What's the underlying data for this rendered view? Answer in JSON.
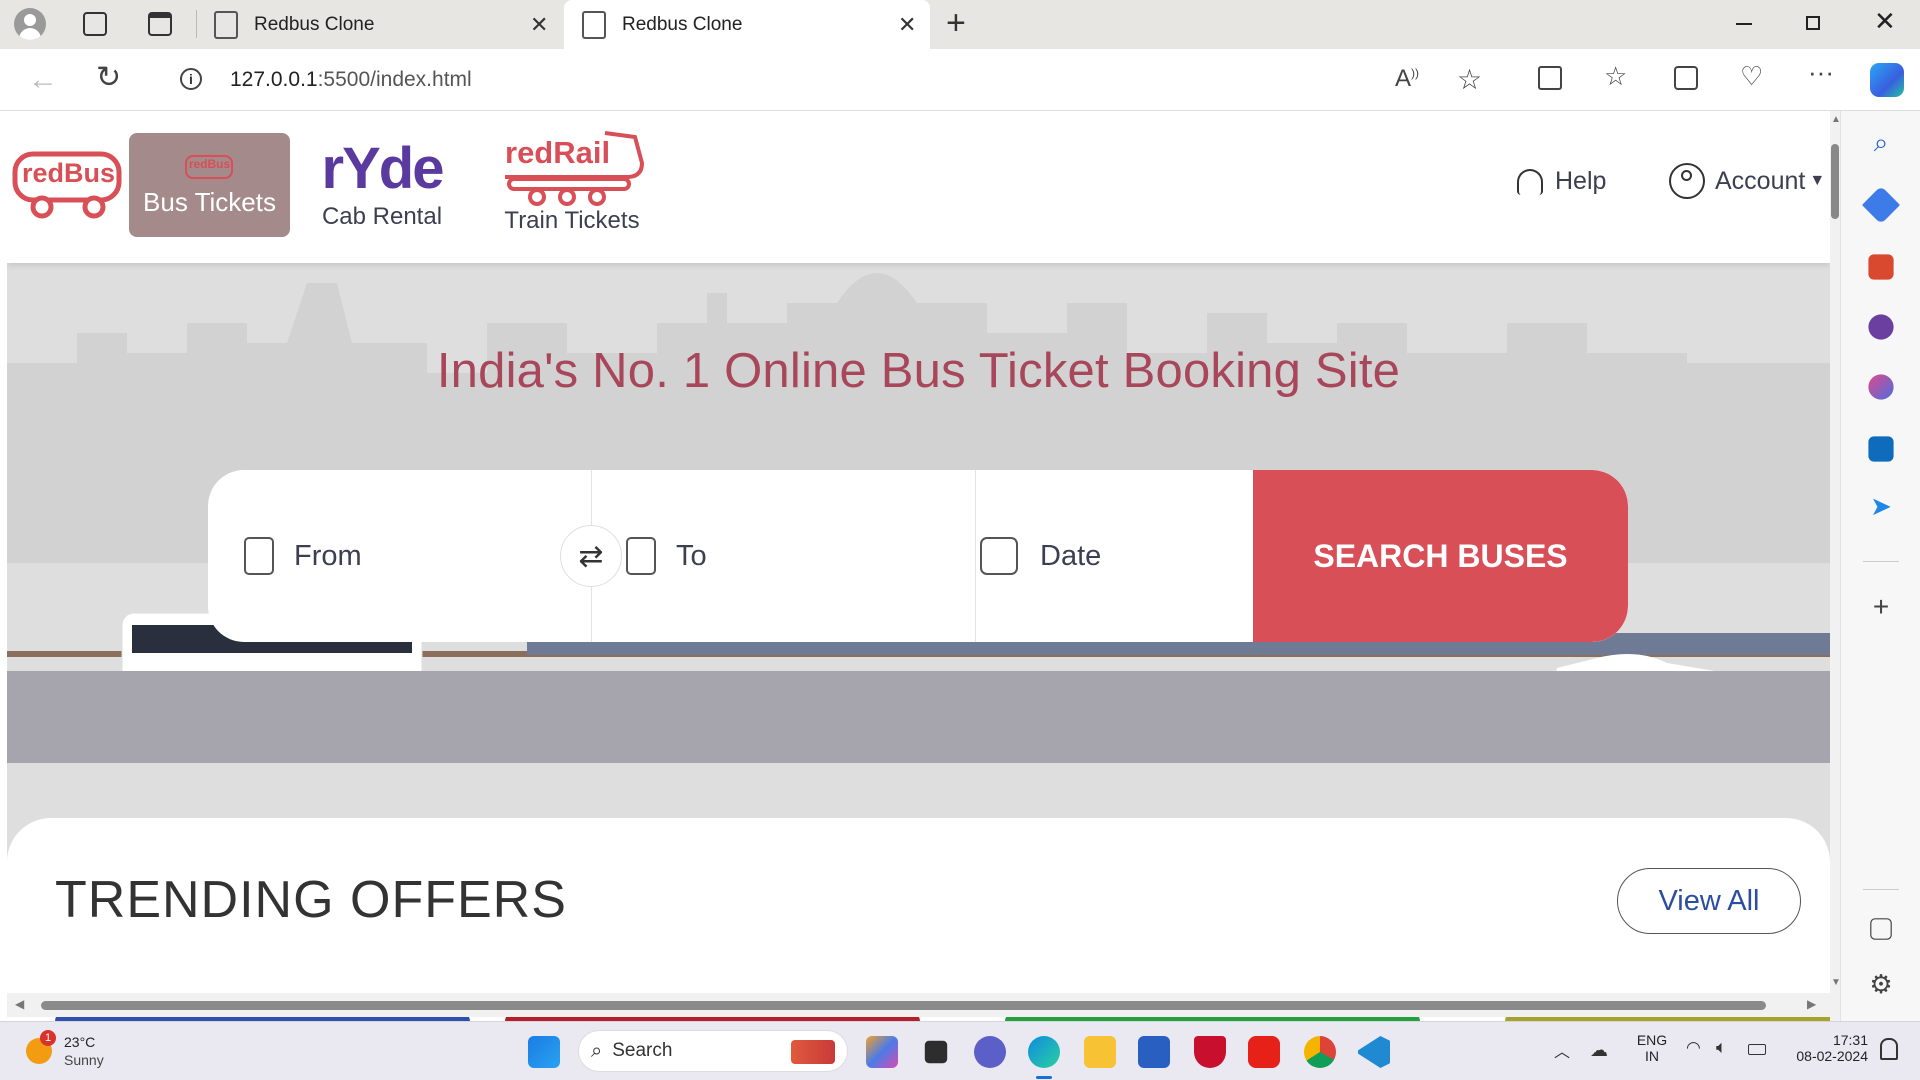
{
  "browser": {
    "tabs": [
      {
        "title": "Redbus Clone",
        "active": false
      },
      {
        "title": "Redbus Clone",
        "active": true
      }
    ],
    "url_host": "127.0.0.1",
    "url_rest": ":5500/index.html",
    "new_tab_symbol": "+"
  },
  "nav": {
    "logo_text": "redBus",
    "bus_tab_logo": "redBus",
    "bus_tab_label": "Bus Tickets",
    "ryde_logo": "rYde",
    "ryde_label": "Cab Rental",
    "rail_logo": "redRail",
    "rail_label": "Train Tickets",
    "help_label": "Help",
    "account_label": "Account"
  },
  "hero": {
    "headline": "India's No. 1 Online Bus Ticket Booking Site",
    "from_label": "From",
    "to_label": "To",
    "date_label": "Date",
    "search_label": "SEARCH BUSES"
  },
  "trending": {
    "title": "TRENDING OFFERS",
    "view_all": "View All",
    "offer_colors": [
      "#2f4fa8",
      "#b51f2a",
      "#24a13f",
      "#a6a32a"
    ]
  },
  "taskbar": {
    "weather_badge": "1",
    "weather_temp": "23°C",
    "weather_desc": "Sunny",
    "search_label": "Search",
    "lang_top": "ENG",
    "lang_bottom": "IN",
    "time": "17:31",
    "date": "08-02-2024"
  },
  "colors": {
    "brand_red": "#d84f57",
    "headline": "#a8465a",
    "bus_tab_bg": "#a48a8a",
    "ryde_purple": "#5b3aa0"
  }
}
